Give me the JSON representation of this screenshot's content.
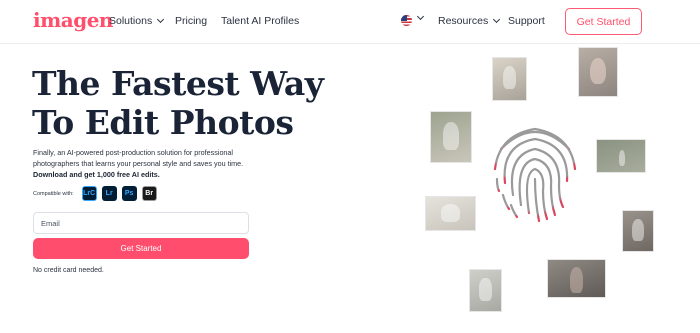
{
  "header": {
    "logo": "imagen",
    "nav": {
      "solutions": "Solutions",
      "pricing": "Pricing",
      "talent": "Talent AI Profiles",
      "resources": "Resources",
      "support": "Support"
    },
    "cta": "Get Started",
    "language_flag": "us-flag-icon"
  },
  "hero": {
    "title_line1": "The Fastest Way",
    "title_line2": "To Edit Photos",
    "description": "Finally, an AI-powered post-production solution for professional photographers that learns your personal style and saves you time.",
    "description_bold": "Download and get 1,000 free AI edits.",
    "compatible_label": "Compatible with:",
    "apps": [
      "LrC",
      "Lr",
      "Ps",
      "Br"
    ],
    "email_placeholder": "Email",
    "cta": "Get Started",
    "note": "No credit card needed."
  },
  "colors": {
    "brand": "#ff4f6b",
    "heading": "#1a2436",
    "cta_bg": "#ff4d6d"
  },
  "icons": [
    "chevron-down-icon",
    "us-flag-icon",
    "fingerprint-icon"
  ]
}
